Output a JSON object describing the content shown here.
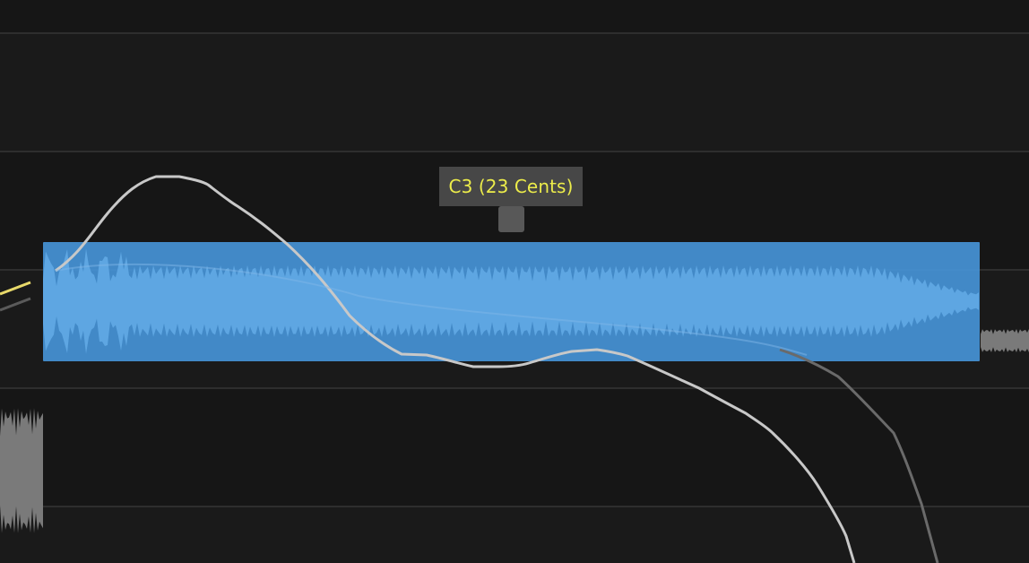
{
  "tooltip": {
    "text": "C3 (23 Cents)"
  },
  "colors": {
    "background": "#1a1a1a",
    "grid_line": "#2e2e2e",
    "note_fill": "#4692d5",
    "note_waveform": "#5ea6e2",
    "pitch_curve_active": "#c8c8c8",
    "pitch_curve_inactive": "#6a6a6a",
    "pitch_curve_selected_prev": "#e8d96a",
    "neighbor_waveform": "#7a7a7a",
    "tooltip_bg": "#474747",
    "tooltip_text": "#ecec4a",
    "handle": "#585858"
  }
}
